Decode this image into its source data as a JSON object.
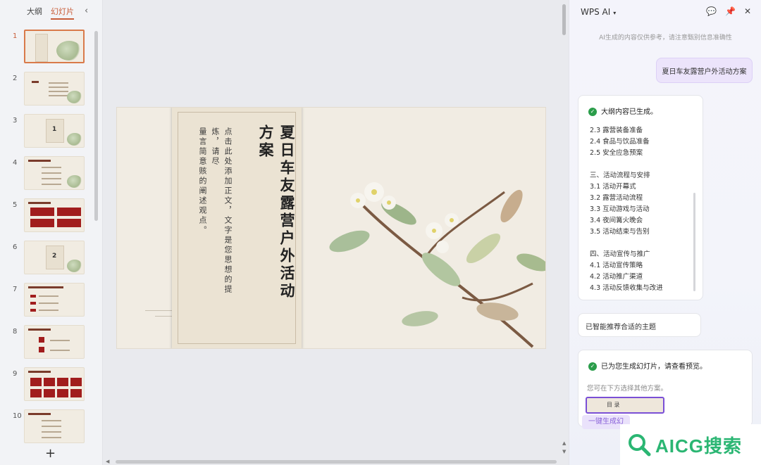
{
  "left_panel": {
    "tabs": [
      {
        "label": "大纲"
      },
      {
        "label": "幻灯片"
      }
    ],
    "active_tab": "幻灯片",
    "collapse_icon": "chevron-left-icon",
    "slides": [
      {
        "num": "1",
        "kind": "title"
      },
      {
        "num": "2",
        "kind": "toc"
      },
      {
        "num": "3",
        "kind": "section"
      },
      {
        "num": "4",
        "kind": "list"
      },
      {
        "num": "5",
        "kind": "red-boxes"
      },
      {
        "num": "6",
        "kind": "section"
      },
      {
        "num": "7",
        "kind": "red-list"
      },
      {
        "num": "8",
        "kind": "red-list"
      },
      {
        "num": "9",
        "kind": "red-grid"
      },
      {
        "num": "10",
        "kind": "list"
      }
    ],
    "add_label": "+"
  },
  "slide": {
    "title": "夏日车友露营户外活动方案",
    "title_col1": "夏日车友露营户外活动",
    "title_col2": "方案",
    "body_col1": "点击此处添加正文，文字是您思想的提炼，请尽",
    "body_col2": "量言简意赅的阐述观点。"
  },
  "ai_panel": {
    "title": "WPS AI",
    "icons": [
      "chat-icon",
      "pin-icon",
      "close-icon"
    ],
    "note": "AI生成的内容仅供参考，请注意甄别信息准确性",
    "user_message": "夏日车友露营户外活动方案",
    "outline_status": "大纲内容已生成。",
    "outline": [
      "2.3 露营装备准备",
      "2.4 食品与饮品准备",
      "2.5 安全应急预案",
      "",
      "三、活动流程与安排",
      "3.1 活动开幕式",
      "3.2 露营活动流程",
      "3.3 互动游戏与活动",
      "3.4 夜间篝火晚会",
      "3.5 活动结束与告别",
      "",
      "四、活动宣传与推广",
      "4.1 活动宣传策略",
      "4.2 活动推广渠道",
      "4.3 活动反馈收集与改进"
    ],
    "theme_msg": "已智能推荐合适的主题",
    "slides_status": "已为您生成幻灯片，请查看预览。",
    "slides_sub": "您可在下方选择其他方案。",
    "preview_text": "目 录",
    "gen_button": "一键生成幻"
  },
  "watermark": {
    "text": "AICG搜索"
  }
}
